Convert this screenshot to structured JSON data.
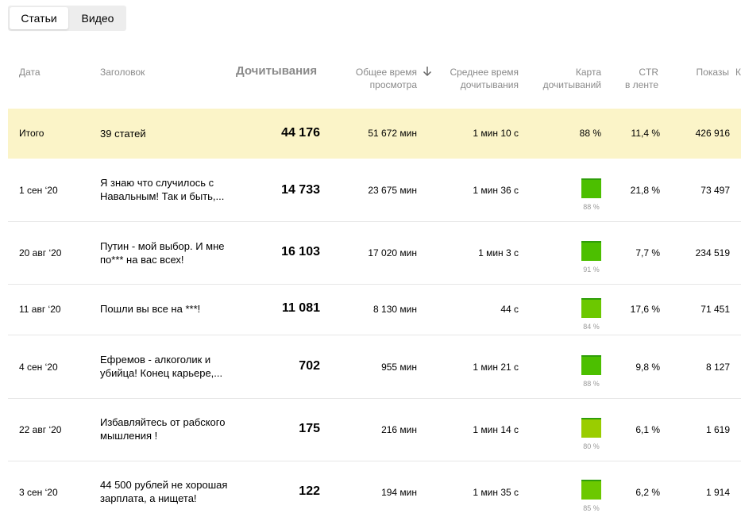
{
  "tabs": [
    {
      "label": "Статьи",
      "active": true
    },
    {
      "label": "Видео",
      "active": false
    }
  ],
  "columns": {
    "date": "Дата",
    "title": "Заголовок",
    "reads": "Дочитывания",
    "total_time_1": "Общее время",
    "total_time_2": "просмотра",
    "avg_time_1": "Среднее время",
    "avg_time_2": "дочитывания",
    "map_1": "Карта",
    "map_2": "дочитываний",
    "ctr_1": "CTR",
    "ctr_2": "в ленте",
    "shows": "Показы",
    "cut": "К"
  },
  "total": {
    "date": "Итого",
    "title": "39 статей",
    "reads": "44 176",
    "total_time": "51 672 мин",
    "avg_time": "1 мин 10 с",
    "map": "88 %",
    "ctr": "11,4 %",
    "shows": "426 916"
  },
  "rows": [
    {
      "date": "1 сен ‘20",
      "title": "Я знаю что случилось с Навальным! Так и быть,...",
      "reads": "14 733",
      "total_time": "23 675 мин",
      "avg_time": "1 мин 36 с",
      "map_pct": "88 %",
      "map_value": 0.88,
      "ctr": "21,8 %",
      "shows": "73 497"
    },
    {
      "date": "20 авг ‘20",
      "title": "Путин - мой выбор. И мне по*** на вас всех!",
      "reads": "16 103",
      "total_time": "17 020 мин",
      "avg_time": "1 мин 3 с",
      "map_pct": "91 %",
      "map_value": 0.91,
      "ctr": "7,7 %",
      "shows": "234 519"
    },
    {
      "date": "11 авг ‘20",
      "title": "Пошли вы все на ***!",
      "reads": "11 081",
      "total_time": "8 130 мин",
      "avg_time": "44 с",
      "map_pct": "84 %",
      "map_value": 0.84,
      "ctr": "17,6 %",
      "shows": "71 451"
    },
    {
      "date": "4 сен ‘20",
      "title": "Ефремов - алкоголик и убийца! Конец карьере,...",
      "reads": "702",
      "total_time": "955 мин",
      "avg_time": "1 мин 21 с",
      "map_pct": "88 %",
      "map_value": 0.88,
      "ctr": "9,8 %",
      "shows": "8 127"
    },
    {
      "date": "22 авг ‘20",
      "title": "Избавляйтесь от рабского мышления !",
      "reads": "175",
      "total_time": "216 мин",
      "avg_time": "1 мин 14 с",
      "map_pct": "80 %",
      "map_value": 0.8,
      "ctr": "6,1 %",
      "shows": "1 619"
    },
    {
      "date": "3 сен ‘20",
      "title": "44 500 рублей не хорошая зарплата, а нищета!",
      "reads": "122",
      "total_time": "194 мин",
      "avg_time": "1 мин 35 с",
      "map_pct": "85 %",
      "map_value": 0.85,
      "ctr": "6,2 %",
      "shows": "1 914"
    }
  ],
  "colors": {
    "total_bg": "#fbf4c8",
    "map_high": "#4cbf00",
    "map_mid": "#6cc800",
    "map_low": "#9acd00"
  }
}
